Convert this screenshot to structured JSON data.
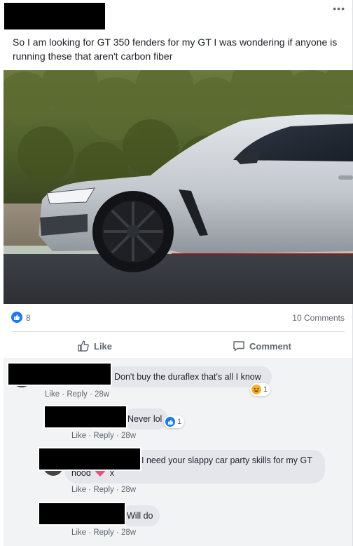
{
  "post": {
    "text": "So I am looking for GT 350 fenders for my GT I was wondering if anyone is running these that aren't carbon fiber",
    "more_icon": "•••"
  },
  "stats": {
    "reaction_count": "8",
    "comments_count": "10 Comments"
  },
  "actions": {
    "like_label": "Like",
    "comment_label": "Comment"
  },
  "comments": [
    {
      "text": "Don't buy the duraflex that's all I know",
      "like": "Like",
      "reply": "Reply",
      "time": "28w",
      "reaction_count": "1",
      "reaction_icon": "haha-icon"
    },
    {
      "text": "Never lol",
      "like": "Like",
      "reply": "Reply",
      "time": "28w",
      "reaction_count": "1",
      "reaction_icon": "like-icon"
    },
    {
      "text_line1": "I need your slappy car party skills for my GT",
      "text_line2_a": "hood",
      "text_line2_b": "x",
      "like": "Like",
      "reply": "Reply",
      "time": "28w"
    },
    {
      "text": "Will do",
      "like": "Like",
      "reply": "Reply",
      "time": "28w"
    }
  ],
  "colors": {
    "accent": "#1877f2",
    "meta": "#606770",
    "bubble": "#e4e6eb",
    "heart": "#f0506e"
  }
}
